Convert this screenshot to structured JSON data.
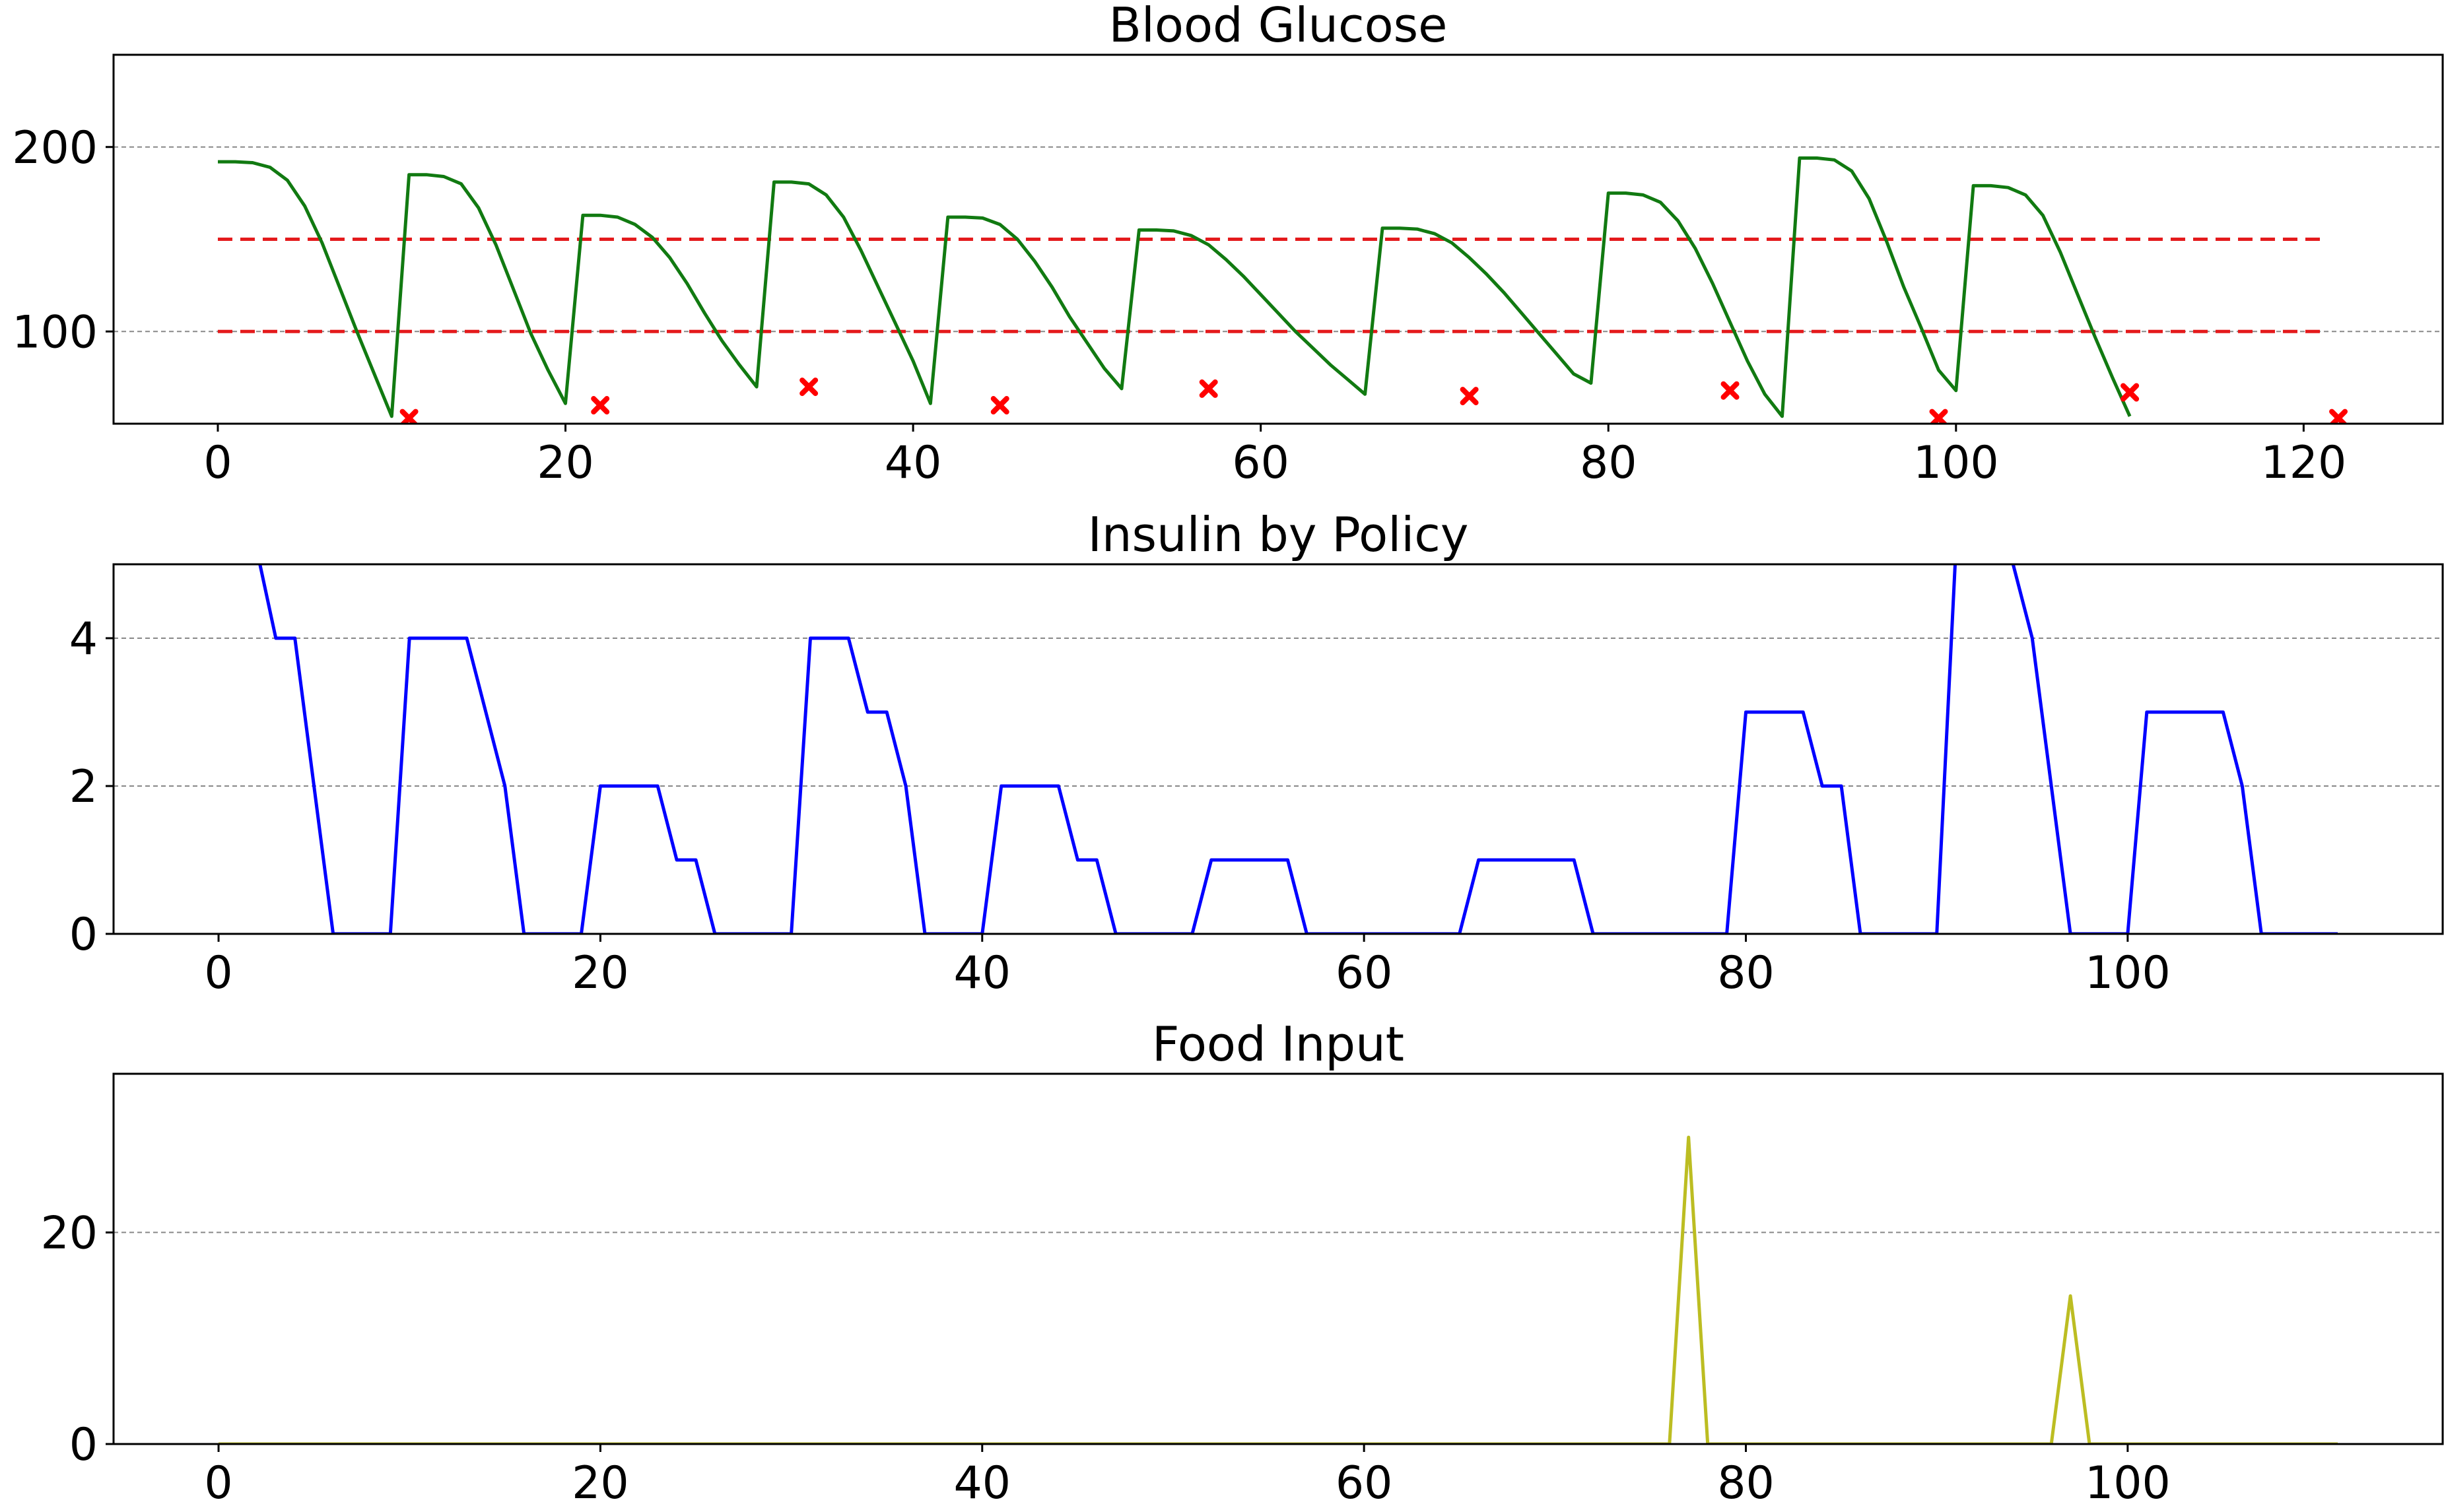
{
  "chart_data": [
    {
      "type": "line",
      "title": "Blood Glucose",
      "xlabel": "",
      "ylabel": "",
      "xlim": [
        -6,
        128
      ],
      "ylim": [
        50,
        250
      ],
      "xticks": [
        0,
        20,
        40,
        60,
        80,
        100,
        120
      ],
      "yticks": [
        100,
        200
      ],
      "grid": "horizontal dashed",
      "reference_lines": [
        {
          "y": 150,
          "x_range": [
            0,
            121
          ],
          "color": "#e41a1c",
          "style": "dashed"
        },
        {
          "y": 100,
          "x_range": [
            0,
            121
          ],
          "color": "#e41a1c",
          "style": "dashed"
        }
      ],
      "series": [
        {
          "color": "#117a11",
          "marker": "none",
          "points": [
            [
              0,
              192
            ],
            [
              1,
              192
            ],
            [
              2,
              191.5
            ],
            [
              3,
              189
            ],
            [
              4,
              182
            ],
            [
              5,
              168
            ],
            [
              6,
              148
            ],
            [
              7,
              124
            ],
            [
              8,
              100
            ],
            [
              9,
              77
            ],
            [
              10,
              54
            ],
            [
              11,
              185
            ],
            [
              12,
              185
            ],
            [
              13,
              184
            ],
            [
              14,
              180
            ],
            [
              15,
              167
            ],
            [
              16,
              147
            ],
            [
              17,
              123
            ],
            [
              18,
              99
            ],
            [
              19,
              79
            ],
            [
              20,
              61
            ],
            [
              21,
              163
            ],
            [
              22,
              163
            ],
            [
              23,
              162
            ],
            [
              24,
              158
            ],
            [
              25,
              151
            ],
            [
              26,
              140
            ],
            [
              27,
              126
            ],
            [
              28,
              110
            ],
            [
              29,
              95
            ],
            [
              30,
              82
            ],
            [
              31,
              70
            ],
            [
              32,
              181
            ],
            [
              33,
              181
            ],
            [
              34,
              180
            ],
            [
              35,
              174
            ],
            [
              36,
              162
            ],
            [
              37,
              144
            ],
            [
              38,
              124
            ],
            [
              39,
              104
            ],
            [
              40,
              84
            ],
            [
              41,
              61
            ],
            [
              42,
              162
            ],
            [
              43,
              162
            ],
            [
              44,
              161.5
            ],
            [
              45,
              158
            ],
            [
              46,
              150
            ],
            [
              47,
              138
            ],
            [
              48,
              124
            ],
            [
              49,
              108
            ],
            [
              50,
              94
            ],
            [
              51,
              80
            ],
            [
              52,
              69
            ],
            [
              53,
              155
            ],
            [
              54,
              155
            ],
            [
              55,
              154.5
            ],
            [
              56,
              152
            ],
            [
              57,
              147
            ],
            [
              58,
              139
            ],
            [
              59,
              130
            ],
            [
              60,
              120
            ],
            [
              61,
              110
            ],
            [
              62,
              100
            ],
            [
              63,
              91
            ],
            [
              64,
              82
            ],
            [
              65,
              74
            ],
            [
              66,
              66
            ],
            [
              67,
              156
            ],
            [
              68,
              156
            ],
            [
              69,
              155.5
            ],
            [
              70,
              153
            ],
            [
              71,
              148
            ],
            [
              72,
              140
            ],
            [
              73,
              131
            ],
            [
              74,
              121
            ],
            [
              75,
              110
            ],
            [
              76,
              99
            ],
            [
              77,
              88
            ],
            [
              78,
              77
            ],
            [
              79,
              72
            ],
            [
              80,
              175
            ],
            [
              81,
              175
            ],
            [
              82,
              174
            ],
            [
              83,
              170
            ],
            [
              84,
              160
            ],
            [
              85,
              145
            ],
            [
              86,
              126
            ],
            [
              87,
              105
            ],
            [
              88,
              84
            ],
            [
              89,
              66
            ],
            [
              90,
              54
            ],
            [
              91,
              194
            ],
            [
              92,
              194
            ],
            [
              93,
              193
            ],
            [
              94,
              187
            ],
            [
              95,
              172
            ],
            [
              96,
              149
            ],
            [
              97,
              124
            ],
            [
              98,
              102
            ],
            [
              99,
              79
            ],
            [
              100,
              68
            ],
            [
              101,
              179
            ],
            [
              102,
              179
            ],
            [
              103,
              178
            ],
            [
              104,
              174
            ],
            [
              105,
              163
            ],
            [
              106,
              143
            ],
            [
              107,
              120
            ],
            [
              108,
              97
            ],
            [
              109,
              75
            ],
            [
              110,
              54
            ]
          ]
        },
        {
          "color": "#ff0000",
          "marker": "x",
          "line": "none",
          "points": [
            [
              11,
              53
            ],
            [
              22,
              60
            ],
            [
              34,
              70
            ],
            [
              45,
              60
            ],
            [
              57,
              69
            ],
            [
              72,
              65
            ],
            [
              87,
              68
            ],
            [
              99,
              53
            ],
            [
              110,
              67
            ],
            [
              122,
              53
            ]
          ]
        }
      ]
    },
    {
      "type": "line",
      "title": "Insulin by Policy",
      "xlabel": "",
      "ylabel": "",
      "xlim": [
        -5.5,
        116.5
      ],
      "ylim": [
        0,
        5
      ],
      "xticks": [
        0,
        20,
        40,
        60,
        80,
        100
      ],
      "yticks": [
        0,
        2,
        4
      ],
      "grid": "horizontal dashed",
      "series": [
        {
          "color": "#0000ff",
          "points": [
            [
              2,
              5.2
            ],
            [
              3,
              4
            ],
            [
              4,
              4
            ],
            [
              5,
              2
            ],
            [
              6,
              0
            ],
            [
              7,
              0
            ],
            [
              8,
              0
            ],
            [
              9,
              0
            ],
            [
              10,
              4
            ],
            [
              11,
              4
            ],
            [
              12,
              4
            ],
            [
              13,
              4
            ],
            [
              14,
              3
            ],
            [
              15,
              2
            ],
            [
              16,
              0
            ],
            [
              17,
              0
            ],
            [
              18,
              0
            ],
            [
              19,
              0
            ],
            [
              20,
              2
            ],
            [
              21,
              2
            ],
            [
              22,
              2
            ],
            [
              23,
              2
            ],
            [
              24,
              1
            ],
            [
              25,
              1
            ],
            [
              26,
              0
            ],
            [
              27,
              0
            ],
            [
              28,
              0
            ],
            [
              29,
              0
            ],
            [
              30,
              0
            ],
            [
              31,
              4
            ],
            [
              32,
              4
            ],
            [
              33,
              4
            ],
            [
              34,
              3
            ],
            [
              35,
              3
            ],
            [
              36,
              2
            ],
            [
              37,
              0
            ],
            [
              38,
              0
            ],
            [
              39,
              0
            ],
            [
              40,
              0
            ],
            [
              41,
              2
            ],
            [
              42,
              2
            ],
            [
              43,
              2
            ],
            [
              44,
              2
            ],
            [
              45,
              1
            ],
            [
              46,
              1
            ],
            [
              47,
              0
            ],
            [
              48,
              0
            ],
            [
              49,
              0
            ],
            [
              50,
              0
            ],
            [
              51,
              0
            ],
            [
              52,
              1
            ],
            [
              53,
              1
            ],
            [
              54,
              1
            ],
            [
              55,
              1
            ],
            [
              56,
              1
            ],
            [
              57,
              0
            ],
            [
              58,
              0
            ],
            [
              59,
              0
            ],
            [
              60,
              0
            ],
            [
              61,
              0
            ],
            [
              62,
              0
            ],
            [
              63,
              0
            ],
            [
              64,
              0
            ],
            [
              65,
              0
            ],
            [
              66,
              1
            ],
            [
              67,
              1
            ],
            [
              68,
              1
            ],
            [
              69,
              1
            ],
            [
              70,
              1
            ],
            [
              71,
              1
            ],
            [
              72,
              0
            ],
            [
              73,
              0
            ],
            [
              74,
              0
            ],
            [
              75,
              0
            ],
            [
              76,
              0
            ],
            [
              77,
              0
            ],
            [
              78,
              0
            ],
            [
              79,
              0
            ],
            [
              80,
              3
            ],
            [
              81,
              3
            ],
            [
              82,
              3
            ],
            [
              83,
              3
            ],
            [
              84,
              2
            ],
            [
              85,
              2
            ],
            [
              86,
              0
            ],
            [
              87,
              0
            ],
            [
              88,
              0
            ],
            [
              89,
              0
            ],
            [
              90,
              0
            ],
            [
              91,
              5.2
            ],
            [
              92,
              5.2
            ],
            [
              93,
              5.2
            ],
            [
              94,
              5
            ],
            [
              95,
              4
            ],
            [
              96,
              2
            ],
            [
              97,
              0
            ],
            [
              98,
              0
            ],
            [
              99,
              0
            ],
            [
              100,
              0
            ],
            [
              101,
              3
            ],
            [
              102,
              3
            ],
            [
              103,
              3
            ],
            [
              104,
              3
            ],
            [
              105,
              3
            ],
            [
              106,
              2
            ],
            [
              107,
              0
            ],
            [
              108,
              0
            ],
            [
              109,
              0
            ],
            [
              110,
              0
            ],
            [
              111,
              0
            ]
          ]
        }
      ]
    },
    {
      "type": "line",
      "title": "Food Input",
      "xlabel": "",
      "ylabel": "",
      "xlim": [
        -5.5,
        116.5
      ],
      "ylim": [
        0,
        35
      ],
      "xticks": [
        0,
        20,
        40,
        60,
        80,
        100
      ],
      "yticks": [
        0,
        20
      ],
      "grid": "horizontal dashed",
      "series": [
        {
          "color": "#bcbd22",
          "points": [
            [
              0,
              0
            ],
            [
              76,
              0
            ],
            [
              77,
              29
            ],
            [
              78,
              0
            ],
            [
              96,
              0
            ],
            [
              97,
              14
            ],
            [
              98,
              0
            ],
            [
              111,
              0
            ]
          ]
        }
      ]
    }
  ]
}
